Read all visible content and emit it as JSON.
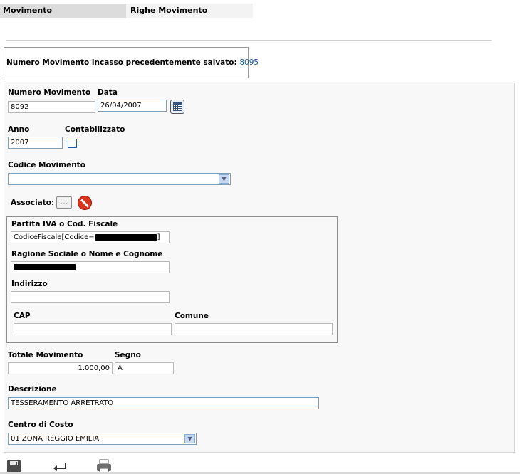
{
  "tabs": [
    {
      "label": "Movimento"
    },
    {
      "label": "Righe Movimento"
    }
  ],
  "message": {
    "text": "Numero Movimento incasso precedentemente salvato:",
    "number": "8095"
  },
  "form": {
    "numero_movimento": {
      "label": "Numero Movimento",
      "value": "8092"
    },
    "data": {
      "label": "Data",
      "value": "26/04/2007"
    },
    "anno": {
      "label": "Anno",
      "value": "2007"
    },
    "contabilizzato": {
      "label": "Contabilizzato",
      "checked": false
    },
    "codice_movimento": {
      "label": "Codice Movimento",
      "value": ""
    },
    "associato": {
      "label": "Associato:",
      "button_label": "..."
    },
    "partita_iva": {
      "label": "Partita IVA o Cod. Fiscale",
      "value_prefix": "CodiceFiscale[Codice=",
      "value_suffix": "]"
    },
    "ragione_sociale": {
      "label": "Ragione Sociale o Nome e Cognome",
      "value": ""
    },
    "indirizzo": {
      "label": "Indirizzo",
      "value": ""
    },
    "cap": {
      "label": "CAP",
      "value": ""
    },
    "comune": {
      "label": "Comune",
      "value": ""
    },
    "totale_movimento": {
      "label": "Totale Movimento",
      "value": "1.000,00"
    },
    "segno": {
      "label": "Segno",
      "value": "A"
    },
    "descrizione": {
      "label": "Descrizione",
      "value": "TESSERAMENTO ARRETRATO"
    },
    "centro_di_costo": {
      "label": "Centro di Costo",
      "value": "01 ZONA REGGIO EMILIA"
    }
  },
  "toolbar": [
    {
      "name": "save-icon"
    },
    {
      "name": "back-arrow-icon"
    },
    {
      "name": "printer-icon"
    }
  ],
  "colors": {
    "link": "#1c5d9f",
    "stop": "#d9361f"
  }
}
